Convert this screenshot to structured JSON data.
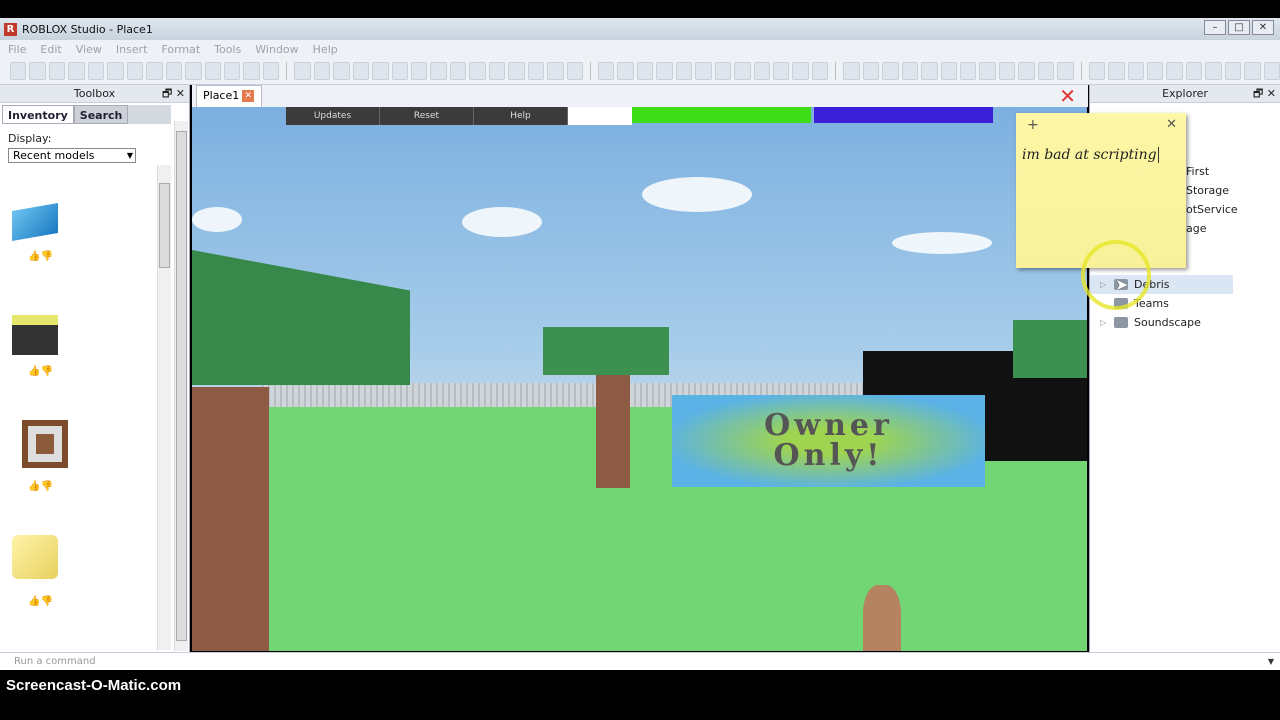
{
  "window": {
    "title": "ROBLOX Studio - Place1",
    "logo": "R"
  },
  "menu": [
    "File",
    "Edit",
    "View",
    "Insert",
    "Format",
    "Tools",
    "Window",
    "Help"
  ],
  "toolbox": {
    "title": "Toolbox",
    "tabs": [
      "Inventory",
      "Search"
    ],
    "display_label": "Display:",
    "display_value": "Recent models"
  },
  "document": {
    "tab": "Place1"
  },
  "game_gui": {
    "buttons": [
      "Updates",
      "Reset",
      "Help"
    ],
    "colors": {
      "bar1": "#3fdc1a",
      "bar2": "#3a1fd6"
    }
  },
  "scene": {
    "sign_line1": "Owner",
    "sign_line2": "Only!"
  },
  "explorer": {
    "title": "Explorer",
    "items": [
      "First",
      "Storage",
      "otService",
      "age",
      "Debris",
      "Teams",
      "Soundscape"
    ]
  },
  "sticky_note": {
    "text": "im bad at scripting"
  },
  "command_bar": {
    "placeholder": "Run a command"
  },
  "watermark": "Screencast-O-Matic.com"
}
